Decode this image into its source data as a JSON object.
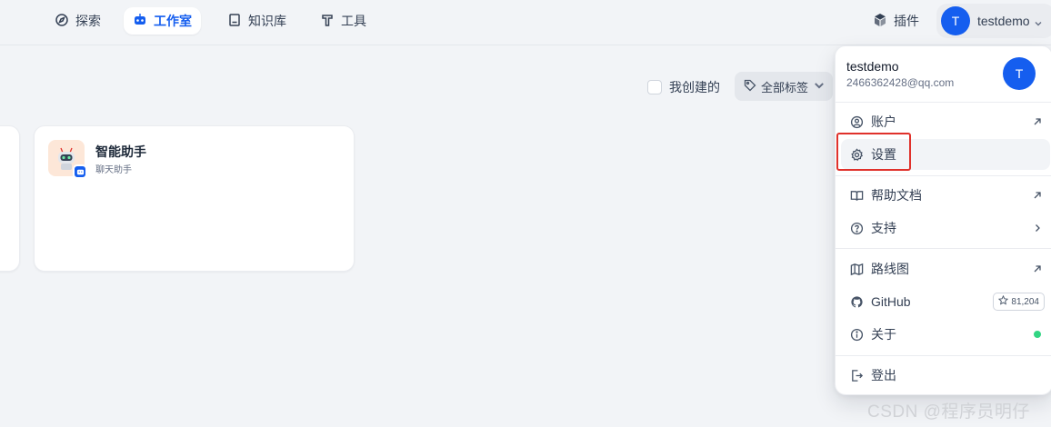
{
  "nav": {
    "items": [
      {
        "label": "探索",
        "icon": "compass-icon"
      },
      {
        "label": "工作室",
        "icon": "robot-icon",
        "active": true
      },
      {
        "label": "知识库",
        "icon": "book-icon"
      },
      {
        "label": "工具",
        "icon": "hammer-icon"
      }
    ],
    "plugin_label": "插件",
    "user": {
      "initial": "T",
      "name": "testdemo"
    }
  },
  "filters": {
    "mine_label": "我创建的",
    "tags_label": "全部标签"
  },
  "apps": [
    {
      "title": "智能助手",
      "subtitle": "聊天助手"
    }
  ],
  "menu": {
    "name": "testdemo",
    "email": "2466362428@qq.com",
    "initial": "T",
    "items": {
      "account": "账户",
      "settings": "设置",
      "help_docs": "帮助文档",
      "support": "支持",
      "roadmap": "路线图",
      "github": "GitHub",
      "github_stars": "81,204",
      "about": "关于",
      "logout": "登出"
    }
  },
  "colors": {
    "accent": "#155eef",
    "highlight": "#e0312b",
    "status_ok": "#32d583"
  },
  "watermark": "CSDN @程序员明仔"
}
